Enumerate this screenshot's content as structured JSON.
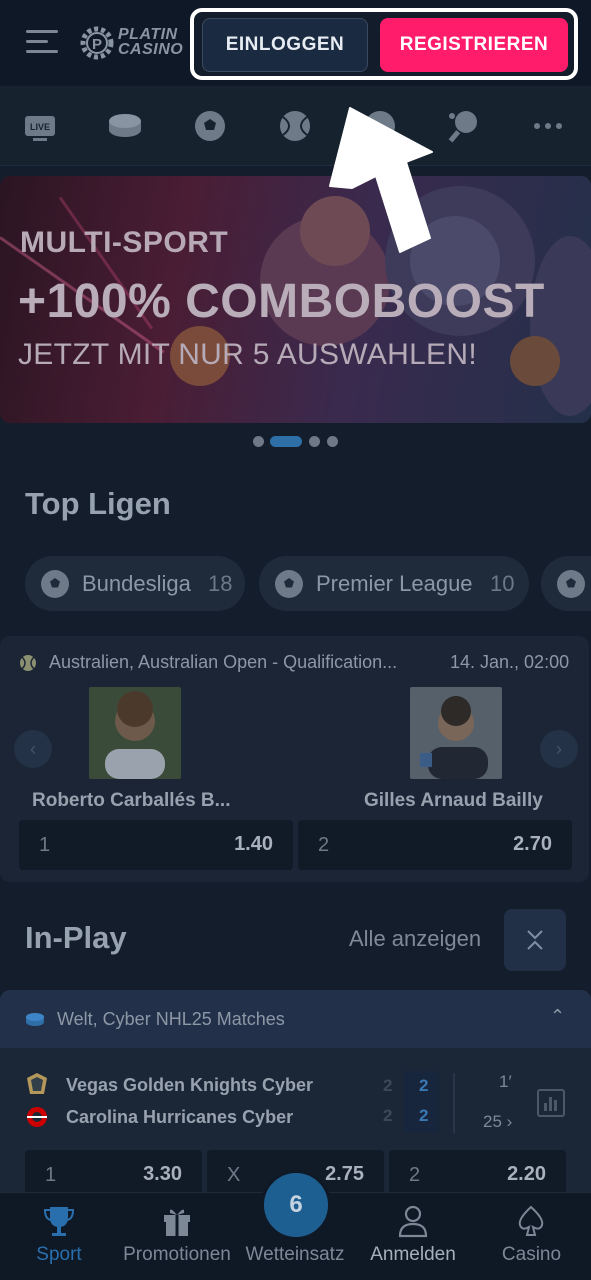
{
  "header": {
    "logo_line1": "PLATIN",
    "logo_line2": "CASINO",
    "login_label": "EINLOGGEN",
    "register_label": "REGISTRIEREN",
    "register_color": "#ff1c6a"
  },
  "sports_nav": {
    "items": [
      "live-tv-icon",
      "hockey-puck-icon",
      "soccer-ball-icon",
      "tennis-ball-icon",
      "basketball-icon",
      "table-tennis-icon",
      "more-icon"
    ],
    "live_badge": "LIVE"
  },
  "banner": {
    "line1": "MULTI-SPORT",
    "line2": "+100% COMBOBOOST",
    "line3": "JETZT MIT NUR 5 AUSWAHLEN!",
    "slide_count": 4,
    "active_slide": 1
  },
  "top_leagues": {
    "title": "Top Ligen",
    "chips": [
      {
        "label": "Bundesliga",
        "count": "18"
      },
      {
        "label": "Premier League",
        "count": "10"
      }
    ]
  },
  "featured_match": {
    "league": "Australien, Australian Open - Qualification...",
    "date": "14. Jan., 02:00",
    "player1": "Roberto Carballés B...",
    "player2": "Gilles Arnaud Bailly",
    "odds": [
      {
        "label": "1",
        "value": "1.40"
      },
      {
        "label": "2",
        "value": "2.70"
      }
    ]
  },
  "inplay": {
    "title": "In-Play",
    "show_all": "Alle anzeigen",
    "league": "Welt, Cyber NHL25 Matches",
    "team1": "Vegas Golden Knights Cyber",
    "team2": "Carolina Hurricanes Cyber",
    "score1": "2",
    "score2": "2",
    "period": "1′",
    "minute": "25",
    "odds": [
      {
        "label": "1",
        "value": "3.30"
      },
      {
        "label": "X",
        "value": "2.75"
      },
      {
        "label": "2",
        "value": "2.20"
      }
    ]
  },
  "bottom_nav": {
    "sport": "Sport",
    "promotions": "Promotionen",
    "betslip": "Wetteinsatz",
    "betslip_count": "6",
    "login": "Anmelden",
    "casino": "Casino",
    "active_color": "#2a6fad"
  }
}
